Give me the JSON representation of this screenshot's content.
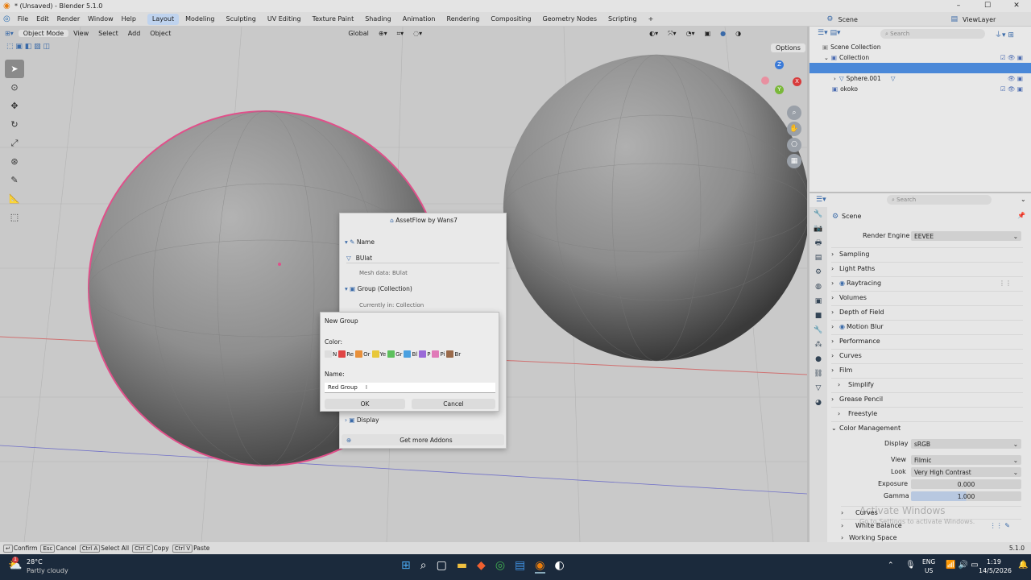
{
  "window": {
    "title": "* (Unsaved) - Blender 5.1.0",
    "controls": [
      "–",
      "☐",
      "✕"
    ]
  },
  "menubar": {
    "menus": [
      "File",
      "Edit",
      "Render",
      "Window",
      "Help"
    ],
    "workspaces": [
      "Layout",
      "Modeling",
      "Sculpting",
      "UV Editing",
      "Texture Paint",
      "Shading",
      "Animation",
      "Rendering",
      "Compositing",
      "Geometry Nodes",
      "Scripting"
    ],
    "active_workspace": "Layout",
    "add_tab": "+",
    "scene": "Scene",
    "view_layer": "ViewLayer"
  },
  "viewport_header": {
    "mode": "Object Mode",
    "menus": [
      "View",
      "Select",
      "Add",
      "Object"
    ],
    "transform": "Global",
    "options": "Options"
  },
  "gizmo": {
    "z": "Z",
    "x": "X",
    "y": "Y"
  },
  "outliner": {
    "search_placeholder": "Search",
    "rows": [
      {
        "label": "Scene Collection",
        "indent": 0,
        "type": "scene"
      },
      {
        "label": "Collection",
        "indent": 1,
        "type": "collection"
      },
      {
        "label": "",
        "indent": 2,
        "type": "selected"
      },
      {
        "label": "Sphere.001",
        "indent": 2,
        "type": "object"
      },
      {
        "label": "okoko",
        "indent": 1,
        "type": "collection"
      }
    ]
  },
  "properties": {
    "search_placeholder": "Search",
    "context": "Scene",
    "render_engine_label": "Render Engine",
    "render_engine": "EEVEE",
    "panels": [
      "Sampling",
      "Light Paths",
      "Raytracing",
      "Volumes",
      "Depth of Field",
      "Motion Blur",
      "Performance",
      "Curves",
      "Film",
      "Simplify",
      "Grease Pencil",
      "Freestyle",
      "Color Management"
    ],
    "color_management": {
      "display_label": "Display",
      "display": "sRGB",
      "view_label": "View",
      "view": "Filmic",
      "look_label": "Look",
      "look": "Very High Contrast",
      "exposure_label": "Exposure",
      "exposure": "0.000",
      "gamma_label": "Gamma",
      "gamma": "1.000"
    },
    "subpanels": [
      "Curves",
      "White Balance",
      "Working Space"
    ],
    "watermark_line1": "Activate Windows",
    "watermark_line2": "Go to Settings to activate Windows."
  },
  "assetflow": {
    "title": "AssetFlow by Wans7",
    "name_section": "Name",
    "name_value": "BUlat",
    "mesh_data": "Mesh data: BUlat",
    "group_section": "Group (Collection)",
    "currently_in": "Currently in: Collection",
    "display_section": "Display",
    "more_addons": "Get more Addons"
  },
  "new_group": {
    "title": "New Group",
    "color_label": "Color:",
    "colors": [
      {
        "label": "N",
        "color": "#dddddd"
      },
      {
        "label": "Re",
        "color": "#e04545"
      },
      {
        "label": "Or",
        "color": "#e8903a"
      },
      {
        "label": "Ye",
        "color": "#e8c83a"
      },
      {
        "label": "Gr",
        "color": "#5cc05c"
      },
      {
        "label": "Bl",
        "color": "#4aa0e0"
      },
      {
        "label": "P",
        "color": "#9a6ad8"
      },
      {
        "label": "Pi",
        "color": "#e07ab8"
      },
      {
        "label": "Br",
        "color": "#9a6a4a"
      }
    ],
    "name_label": "Name:",
    "name_value": "Red Group",
    "ok": "OK",
    "cancel": "Cancel"
  },
  "statusbar": {
    "items": [
      {
        "key": "↵",
        "label": "Confirm"
      },
      {
        "key": "Esc",
        "label": "Cancel"
      },
      {
        "key": "Ctrl A",
        "label": "Select All"
      },
      {
        "key": "Ctrl C",
        "label": "Copy"
      },
      {
        "key": "Ctrl V",
        "label": "Paste"
      }
    ],
    "version": "5.1.0"
  },
  "taskbar": {
    "temperature": "28°C",
    "weather": "Partly cloudy",
    "notification_count": "1",
    "lang_line1": "ENG",
    "lang_line2": "US",
    "time": "1:19",
    "date": "14/5/2026"
  },
  "colors": {
    "accent": "#4a88d8",
    "selection_outline": "#e0508a",
    "taskbar": "#1b2a3c"
  }
}
